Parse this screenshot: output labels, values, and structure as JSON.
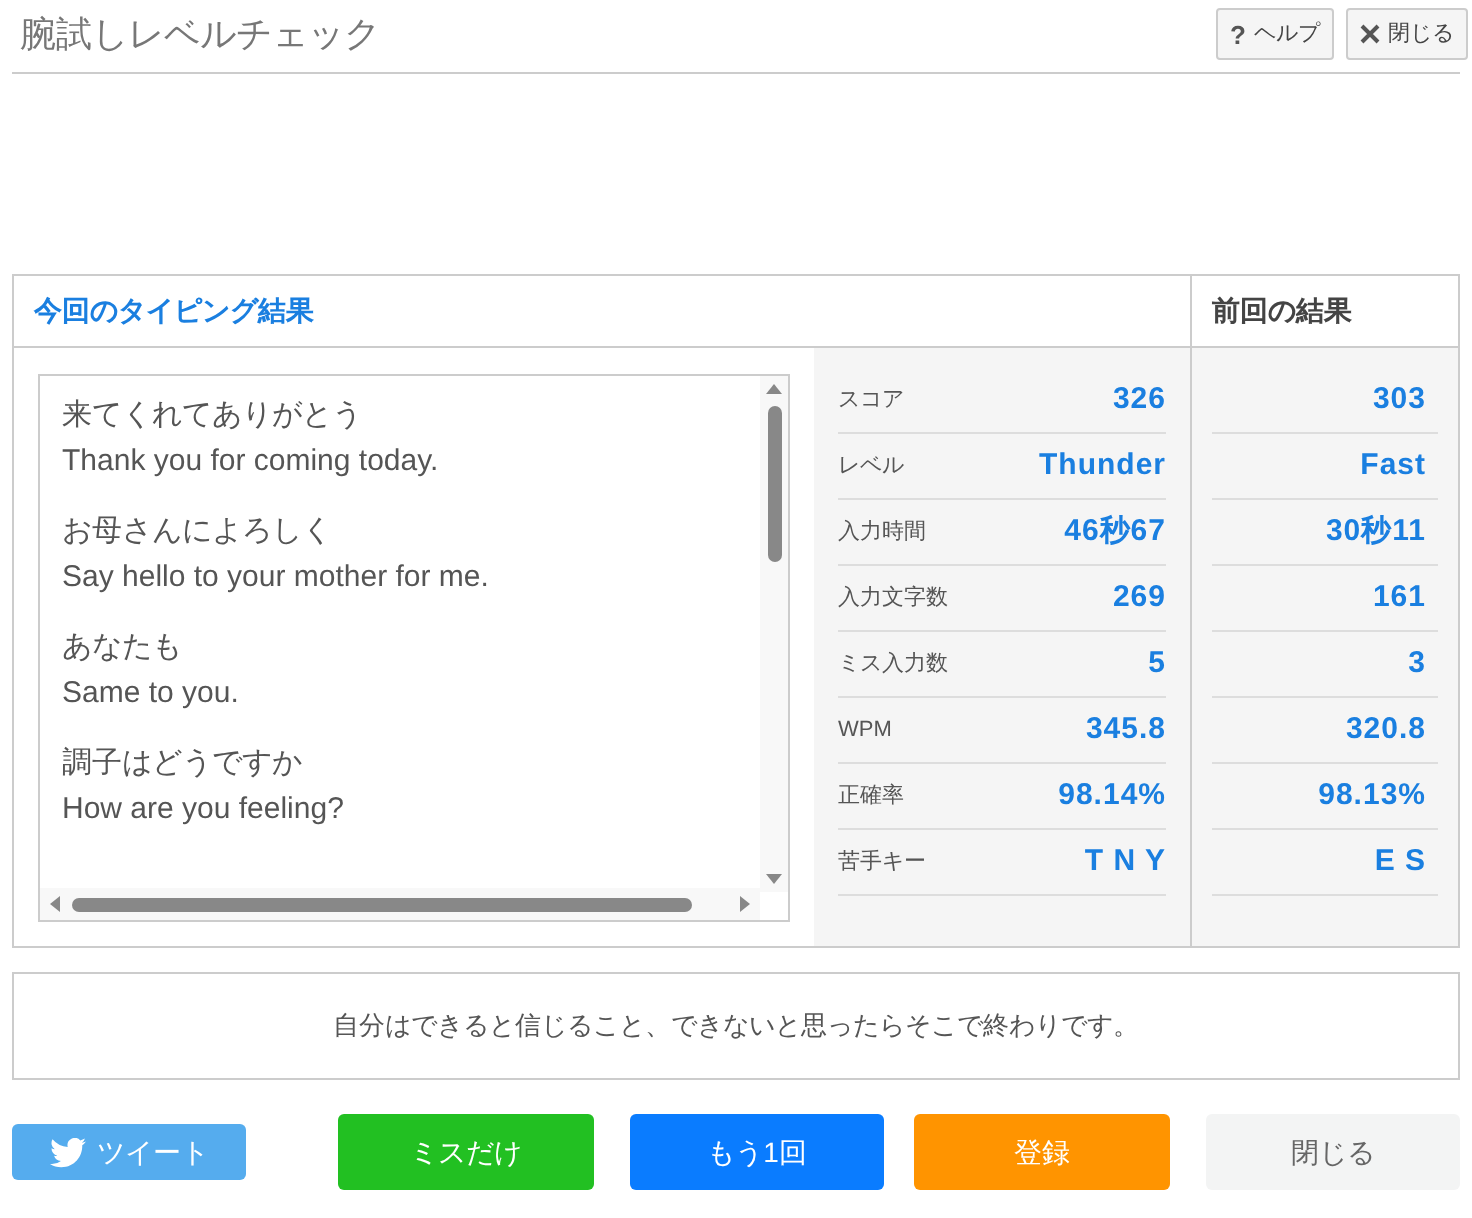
{
  "title": "腕試しレベルチェック",
  "header_buttons": [
    {
      "kind": "help",
      "icon": "?",
      "label": "ヘルプ"
    },
    {
      "kind": "close",
      "label": "閉じる"
    }
  ],
  "current": {
    "heading": "今回のタイピング結果",
    "phrases": [
      {
        "ja": "来てくれてありがとう",
        "en": "Thank you for coming today."
      },
      {
        "ja": "お母さんによろしく",
        "en": "Say hello to your mother for me."
      },
      {
        "ja": "あなたも",
        "en": "Same to you."
      },
      {
        "ja": "調子はどうですか",
        "en": "How are you feeling?"
      }
    ]
  },
  "previous": {
    "heading": "前回の結果"
  },
  "stats": [
    {
      "label": "スコア",
      "current": "326",
      "previous": "303"
    },
    {
      "label": "レベル",
      "current": "Thunder",
      "previous": "Fast"
    },
    {
      "label": "入力時間",
      "current": "46秒67",
      "previous": "30秒11"
    },
    {
      "label": "入力文字数",
      "current": "269",
      "previous": "161"
    },
    {
      "label": "ミス入力数",
      "current": "5",
      "previous": "3"
    },
    {
      "label": "WPM",
      "current": "345.8",
      "previous": "320.8"
    },
    {
      "label": "正確率",
      "current": "98.14%",
      "previous": "98.13%"
    },
    {
      "label": "苦手キー",
      "current": "T N Y",
      "previous": "E S"
    }
  ],
  "quote": "自分はできると信じること、できないと思ったらそこで終わりです。",
  "actions": [
    {
      "kind": "tweet",
      "label": "ツイート"
    },
    {
      "kind": "green",
      "label": "ミスだけ"
    },
    {
      "kind": "blue",
      "label": "もう1回"
    },
    {
      "kind": "orange",
      "label": "登録"
    },
    {
      "kind": "grey",
      "label": "閉じる"
    }
  ]
}
